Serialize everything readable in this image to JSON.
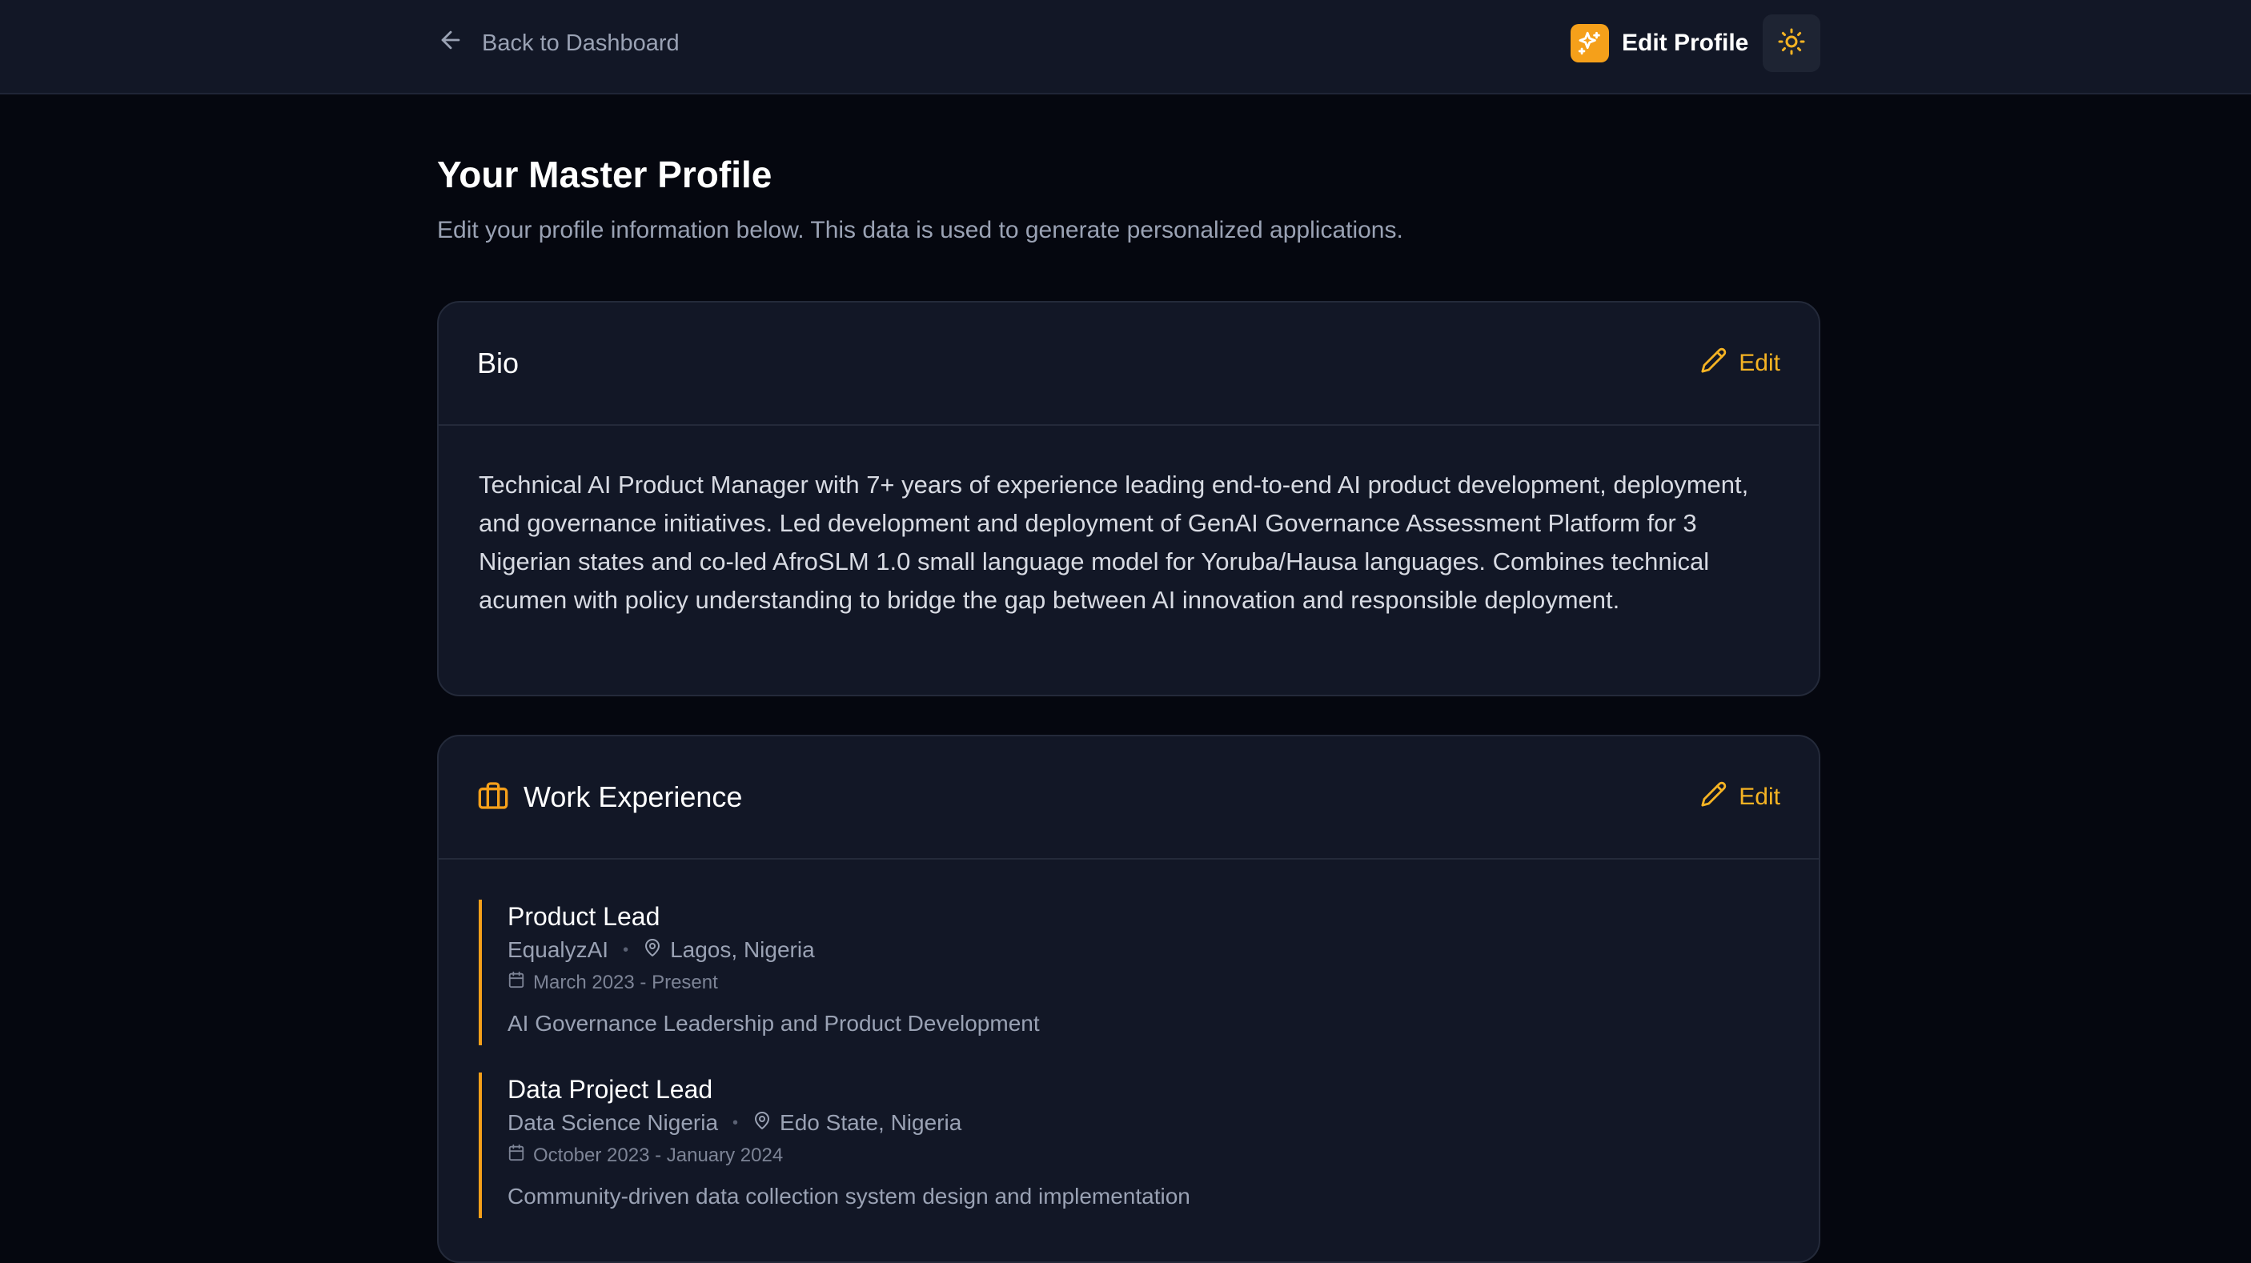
{
  "header": {
    "back_label": "Back to Dashboard",
    "brand_title": "Edit Profile",
    "accent_color": "#f5a01a"
  },
  "page": {
    "title": "Your Master Profile",
    "subtitle": "Edit your profile information below. This data is used to generate personalized applications."
  },
  "bio": {
    "title": "Bio",
    "edit_label": "Edit",
    "text": "Technical AI Product Manager with 7+ years of experience leading end-to-end AI product development, deployment, and governance initiatives. Led development and deployment of GenAI Governance Assessment Platform for 3 Nigerian states and co-led AfroSLM 1.0 small language model for Yoruba/Hausa languages. Combines technical acumen with policy understanding to bridge the gap between AI innovation and responsible deployment."
  },
  "work": {
    "title": "Work Experience",
    "edit_label": "Edit",
    "items": [
      {
        "role": "Product Lead",
        "company": "EqualyzAI",
        "location": "Lagos, Nigeria",
        "dates": "March 2023 - Present",
        "description": "AI Governance Leadership and Product Development"
      },
      {
        "role": "Data Project Lead",
        "company": "Data Science Nigeria",
        "location": "Edo State, Nigeria",
        "dates": "October 2023 - January 2024",
        "description": "Community-driven data collection system design and implementation"
      }
    ]
  },
  "icons": {
    "back": "arrow-left-icon",
    "brand": "sparkles-icon",
    "theme": "sun-icon",
    "edit": "pencil-icon",
    "work": "briefcase-icon",
    "location": "map-pin-icon",
    "calendar": "calendar-icon"
  }
}
